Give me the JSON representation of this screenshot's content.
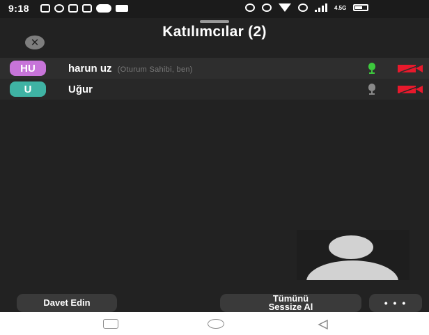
{
  "status_bar": {
    "time": "9:18",
    "network_label": "4.5G",
    "icons_left": [
      "gallery-icon",
      "whatsapp-icon",
      "instagram-icon",
      "instagram-icon",
      "messenger-icon",
      "video-icon"
    ],
    "icons_right": [
      "alarm-icon",
      "vibrate-icon",
      "wifi-icon",
      "volte-icon",
      "signal-icon",
      "battery-icon"
    ]
  },
  "header": {
    "title": "Katılımcılar (2)",
    "close_icon": "close-icon"
  },
  "participants": [
    {
      "initials": "HU",
      "name": "harun uz",
      "role": "(Oturum Sahibi, ben)",
      "avatar_color": "#c774d9",
      "mic_color": "#3dc93d",
      "camera_off_color": "#e8192c"
    },
    {
      "initials": "U",
      "name": "Uğur",
      "role": "",
      "avatar_color": "#3fb3a4",
      "mic_color": "#8a8a8a",
      "camera_off_color": "#e8192c"
    }
  ],
  "footer": {
    "invite_label": "Davet Edin",
    "mute_all_line1": "Tümünü",
    "mute_all_line2": "Sessize Al",
    "more_label": "• • •"
  },
  "nav_bar": {
    "icons": [
      "recent-apps-icon",
      "home-icon",
      "back-icon"
    ]
  },
  "colors": {
    "background": "#222222",
    "button_bg": "#3a3a3a",
    "self_avatar": "#d2d2d2"
  }
}
